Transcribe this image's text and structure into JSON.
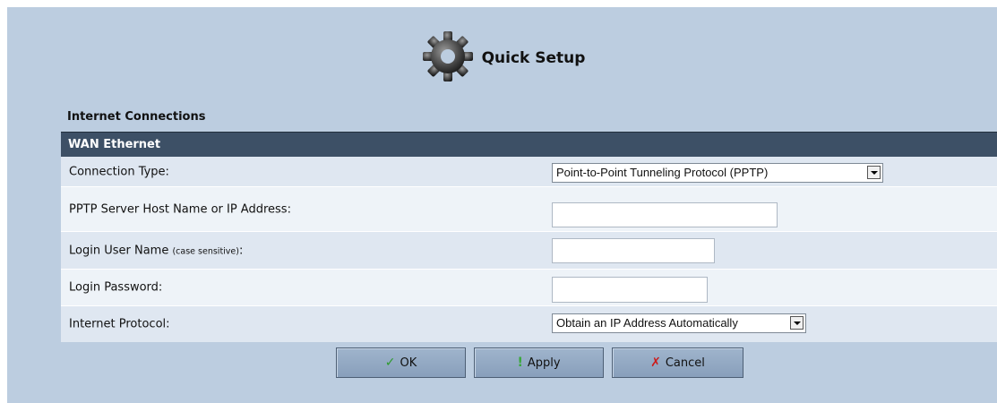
{
  "header": {
    "title": "Quick Setup"
  },
  "section": {
    "label": "Internet Connections"
  },
  "wan": {
    "heading": "WAN Ethernet"
  },
  "form": {
    "connection_type": {
      "label": "Connection Type:",
      "value": "Point-to-Point Tunneling Protocol (PPTP)"
    },
    "pptp_server": {
      "label": "PPTP Server Host Name or IP Address:",
      "value": ""
    },
    "login_user": {
      "label": "Login User Name",
      "note": "(case sensitive)",
      "suffix": ":",
      "value": ""
    },
    "login_password": {
      "label": "Login Password:",
      "value": ""
    },
    "internet_protocol": {
      "label": "Internet Protocol:",
      "value": "Obtain an IP Address Automatically"
    }
  },
  "buttons": {
    "ok": {
      "label": "OK",
      "icon": "check-icon"
    },
    "apply": {
      "label": "Apply",
      "icon": "exclamation-icon"
    },
    "cancel": {
      "label": "Cancel",
      "icon": "x-icon"
    }
  },
  "colors": {
    "panel_bg": "#bccde0",
    "wan_bar": "#3d5066",
    "row_a": "#dfe7f1",
    "row_b": "#eef3f8"
  }
}
